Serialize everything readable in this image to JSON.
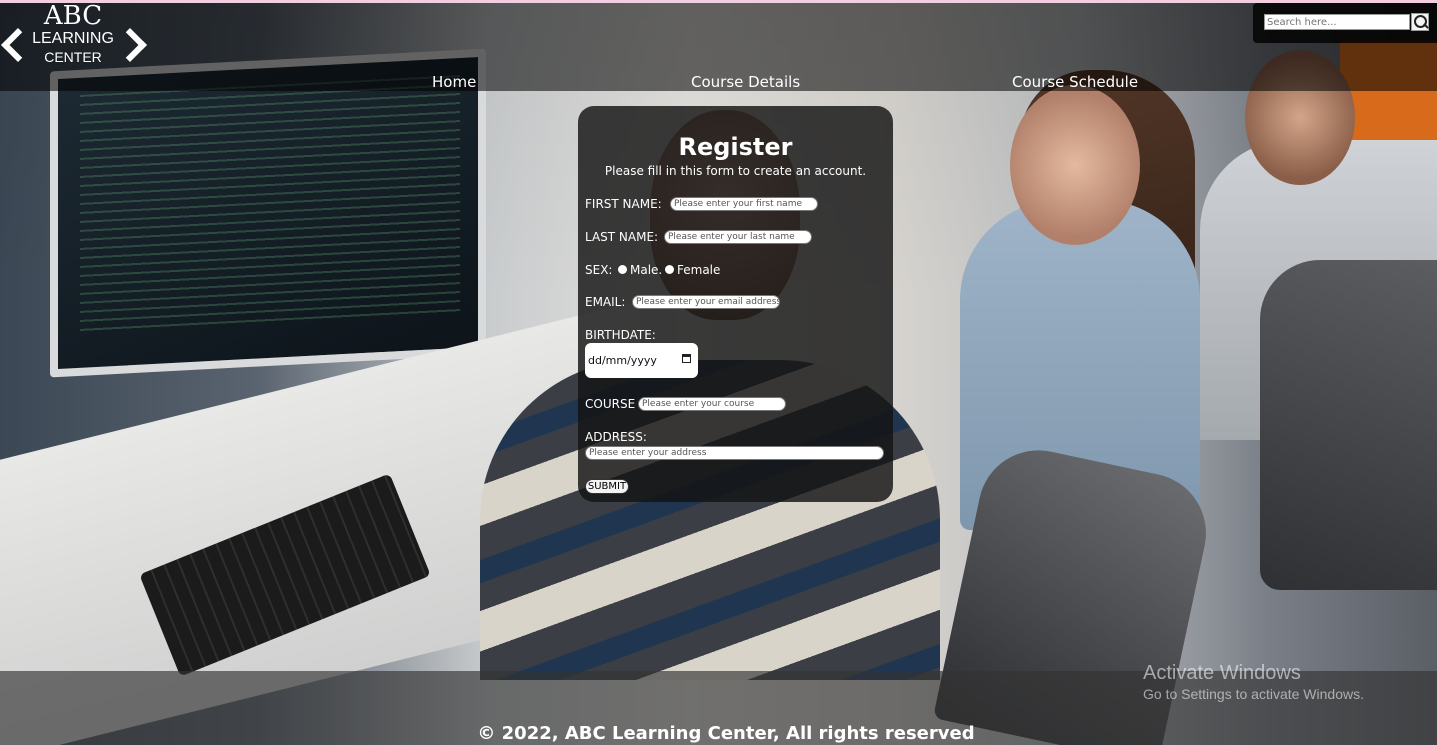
{
  "logo": {
    "line1": "ABC",
    "line2": "LEARNING",
    "line3": "CENTER"
  },
  "nav": {
    "items": [
      "Home",
      "Course Details",
      "Course Schedule"
    ]
  },
  "search": {
    "placeholder": "Search here..."
  },
  "form": {
    "title": "Register",
    "subtitle": "Please fill in this form to create an account.",
    "first_name_label": "FIRST NAME:",
    "first_name_placeholder": "Please enter your first name",
    "last_name_label": "LAST NAME:",
    "last_name_placeholder": "Please enter your last name",
    "sex_label": "SEX:",
    "sex_options": [
      "Male.",
      "Female"
    ],
    "email_label": "EMAIL:",
    "email_placeholder": "Please enter your email address",
    "birthdate_label": "BIRTHDATE:",
    "birthdate_value": "dd/mm/yyyy",
    "course_label": "COURSE",
    "course_placeholder": "Please enter your course",
    "address_label": "ADDRESS:",
    "address_placeholder": "Please enter your address",
    "submit_label": "SUBMIT"
  },
  "footer": {
    "text": "© 2022, ABC Learning Center, All rights reserved"
  },
  "watermark": {
    "title": "Activate Windows",
    "subtitle": "Go to Settings to activate Windows."
  }
}
